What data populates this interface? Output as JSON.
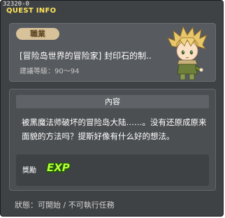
{
  "window": {
    "quest_id": "32320-0",
    "title": "QUEST INFO"
  },
  "header": {
    "category": "職業",
    "quest_name": "[冒险岛世界的冒险家] 封印石的制..",
    "level_label": "建議等級：90～94"
  },
  "content": {
    "section_title": "內容",
    "description": "被黑魔法师破坏的冒险岛大陆……。没有还原成原来面貌的方法吗？提斯好像有什么好的想法。"
  },
  "reward": {
    "label": "獎勵",
    "exp_icon_text": "EXP"
  },
  "status": {
    "text": "狀態：可開始 / 不可執行任務"
  },
  "colors": {
    "title": "#ffe45a",
    "badge": "#d8c29a",
    "exp": "#b4ff3a"
  }
}
